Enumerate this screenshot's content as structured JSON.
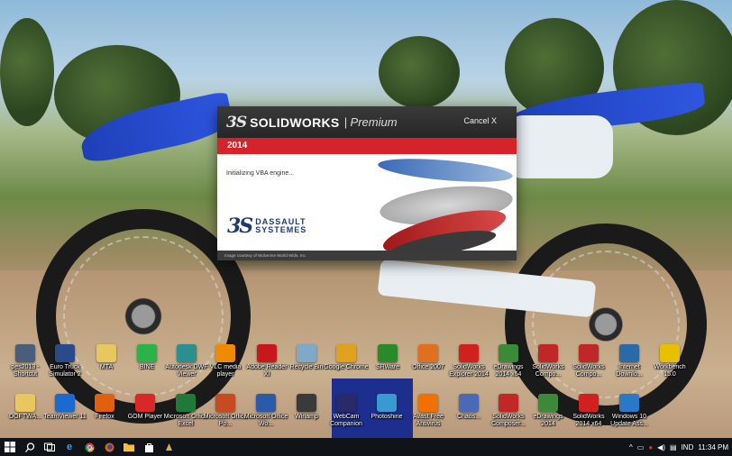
{
  "splash": {
    "brand": "SOLIDWORKS",
    "edition": "| Premium",
    "cancel_label": "Cancel X",
    "year": "2014",
    "status": "Initializing VBA engine...",
    "dassault_line1": "DASSAULT",
    "dassault_line2": "SYSTEMES",
    "credit": "Image courtesy of Wolverine World Wide, Inc."
  },
  "desktop_icons": [
    {
      "label": "pes2013 - Shortcut",
      "icon": "game-icon",
      "color": "#4a5d7a"
    },
    {
      "label": "Euro Truck Simulator 2",
      "icon": "truck-icon",
      "color": "#2a4a8a"
    },
    {
      "label": "MTA",
      "icon": "folder-icon",
      "color": "#e8c760"
    },
    {
      "label": "BINE",
      "icon": "chat-icon",
      "color": "#2bb34a"
    },
    {
      "label": "Autodesk DWF Viewer",
      "icon": "autodesk-icon",
      "color": "#2b8f8f"
    },
    {
      "label": "VLC media player",
      "icon": "vlc-icon",
      "color": "#f08a00"
    },
    {
      "label": "Adobe Reader XI",
      "icon": "pdf-icon",
      "color": "#c8181e"
    },
    {
      "label": "Recycle Bin",
      "icon": "recycle-bin-icon",
      "color": "#7fa8c9"
    },
    {
      "label": "Google Chrome",
      "icon": "chrome-icon",
      "color": "#e0a020"
    },
    {
      "label": "SRWare",
      "icon": "srware-icon",
      "color": "#2a8a2a"
    },
    {
      "label": "Office 2007",
      "icon": "office-icon",
      "color": "#e07020"
    },
    {
      "label": "SolidWorks Explorer 2014",
      "icon": "solidworks-icon",
      "color": "#d02020"
    },
    {
      "label": "eDrawings 2014 x64",
      "icon": "edrawings-icon",
      "color": "#3a8a3a"
    },
    {
      "label": "SolidWorks Compo...",
      "icon": "solidworks-icon",
      "color": "#c02828"
    },
    {
      "label": "SolidWorks Compo...",
      "icon": "solidworks-icon",
      "color": "#c02828"
    },
    {
      "label": "Internet Downlo...",
      "icon": "download-icon",
      "color": "#2a6aa8"
    },
    {
      "label": "Workbench 15.0",
      "icon": "ansys-icon",
      "color": "#e8c000"
    },
    {
      "label": "DOFTWA...",
      "icon": "folder-icon",
      "color": "#e8c760"
    },
    {
      "label": "TeamViewer 11",
      "icon": "teamviewer-icon",
      "color": "#1a6ad0"
    },
    {
      "label": "Firefox",
      "icon": "firefox-icon",
      "color": "#e06010"
    },
    {
      "label": "GOM Player",
      "icon": "gom-icon",
      "color": "#d82828"
    },
    {
      "label": "Microsoft Office Excel",
      "icon": "excel-icon",
      "color": "#1f7a3a"
    },
    {
      "label": "Microsoft Office Po...",
      "icon": "powerpoint-icon",
      "color": "#c84a20"
    },
    {
      "label": "Microsoft Office Wo...",
      "icon": "word-icon",
      "color": "#2a5aa8"
    },
    {
      "label": "Winamp",
      "icon": "winamp-icon",
      "color": "#3a3a3a"
    },
    {
      "label": "WebCam Companion",
      "icon": "webcam-icon",
      "color": "#2a2a6a"
    },
    {
      "label": "Photoshine",
      "icon": "photoshine-icon",
      "color": "#3a9ad0"
    },
    {
      "label": "Avast Free Antivirus",
      "icon": "avast-icon",
      "color": "#f07000"
    },
    {
      "label": "Chaos...",
      "icon": "globe-icon",
      "color": "#4a6ab8"
    },
    {
      "label": "SolidWorks Composer...",
      "icon": "solidworks-icon",
      "color": "#c02828"
    },
    {
      "label": "eDrawings 2014",
      "icon": "edrawings-icon",
      "color": "#3a8a3a"
    },
    {
      "label": "SolidWorks 2014 x64",
      "icon": "solidworks-icon",
      "color": "#d02020"
    },
    {
      "label": "Windows 10 Update Ass...",
      "icon": "windows-update-icon",
      "color": "#2a78c8"
    }
  ],
  "taskbar": {
    "language": "IND",
    "clock": "11:34 PM"
  }
}
